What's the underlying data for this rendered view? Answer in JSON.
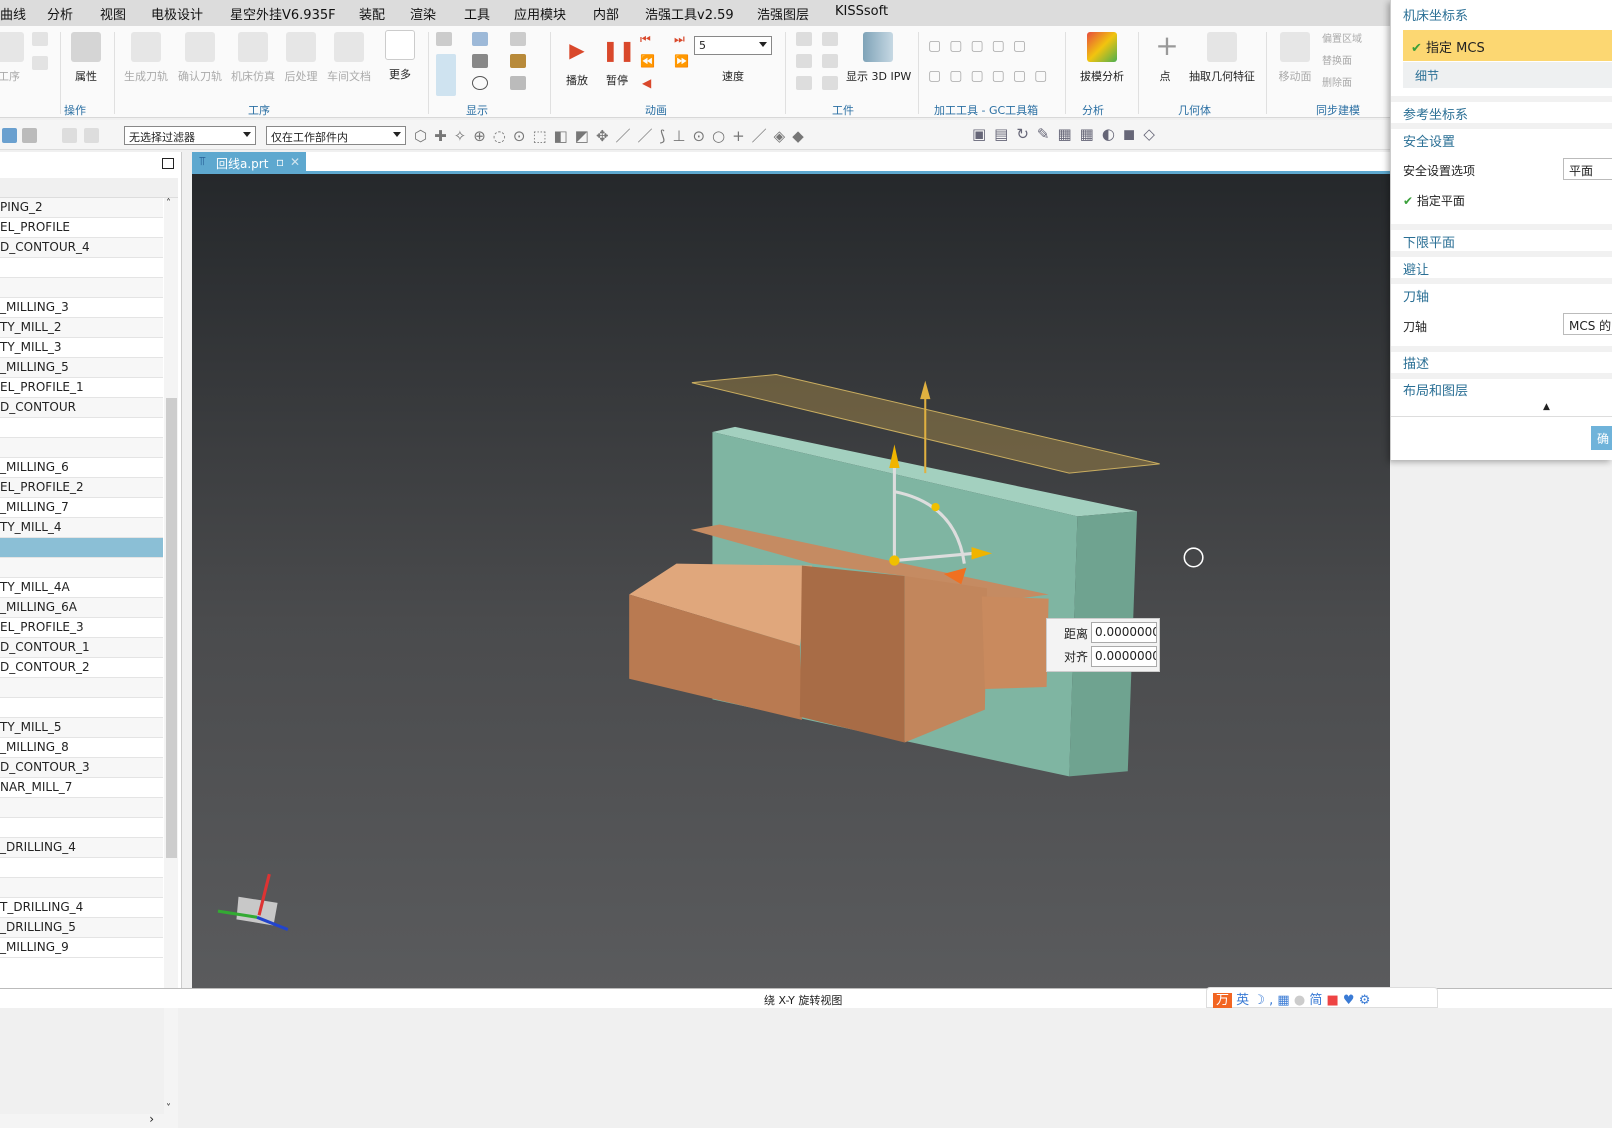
{
  "menu": [
    "曲线",
    "分析",
    "视图",
    "电极设计",
    "星空外挂V6.935F",
    "装配",
    "渲染",
    "工具",
    "应用模块",
    "内部",
    "浩强工具v2.59",
    "浩强图层",
    "KISSsoft"
  ],
  "ribbon": {
    "buttons": {
      "op": "工序",
      "props": "属性",
      "gen": "生成刀轨",
      "verify": "确认刀轨",
      "sim": "机床仿真",
      "post": "后处理",
      "shop": "车间文档",
      "more": "更多",
      "play": "播放",
      "pause": "暂停",
      "speed": "速度",
      "speed_value": "5",
      "ipw": "显示 3D IPW",
      "draft": "拔模分析",
      "point": "点",
      "extract": "抽取几何特征",
      "move_face": "移动面",
      "offset": "偏置区域",
      "replace": "替换面",
      "delete": "删除面"
    },
    "groups": [
      "操作",
      "工序",
      "显示",
      "动画",
      "工件",
      "加工工具 - GC工具箱",
      "分析",
      "几何体",
      "同步建模"
    ]
  },
  "toolbar": {
    "filter": "无选择过滤器",
    "scope": "仅在工作部件内"
  },
  "tab": {
    "label": "回线a.prt"
  },
  "tree": [
    "PING_2",
    "EL_PROFILE",
    "D_CONTOUR_4",
    "",
    "",
    "_MILLING_3",
    "TY_MILL_2",
    "TY_MILL_3",
    "_MILLING_5",
    "EL_PROFILE_1",
    "D_CONTOUR",
    "",
    "",
    "_MILLING_6",
    "EL_PROFILE_2",
    "_MILLING_7",
    "TY_MILL_4",
    "",
    "",
    "TY_MILL_4A",
    "_MILLING_6A",
    "EL_PROFILE_3",
    "D_CONTOUR_1",
    "D_CONTOUR_2",
    "",
    "",
    "TY_MILL_5",
    "_MILLING_8",
    "D_CONTOUR_3",
    "NAR_MILL_7",
    "",
    "",
    "_DRILLING_4",
    "",
    "",
    "T_DRILLING_4",
    "_DRILLING_5",
    "_MILLING_9"
  ],
  "tree_selected_index": 17,
  "panel": {
    "mcs_header": "机床坐标系",
    "specify_mcs": "指定 MCS",
    "details": "细节",
    "ref_csys": "参考坐标系",
    "safety": "安全设置",
    "safety_option_label": "安全设置选项",
    "safety_option_value": "平面",
    "specify_plane": "指定平面",
    "lower_plane": "下限平面",
    "avoid": "避让",
    "tool_axis_header": "刀轴",
    "tool_axis_label": "刀轴",
    "tool_axis_value": "MCS 的",
    "desc": "描述",
    "layout": "布局和图层",
    "ok": "确"
  },
  "distance_box": {
    "dist_label": "距离",
    "dist_value": "0.0000000",
    "align_label": "对齐",
    "align_value": "0.0000000"
  },
  "status": {
    "text": "绕 X-Y 旋转视图"
  },
  "ime": [
    "英",
    "简"
  ],
  "colors": {
    "accent": "#5ea8cf",
    "highlight": "#fcd772",
    "plate": "#7fb5a2",
    "copper": "#c98a5e"
  }
}
